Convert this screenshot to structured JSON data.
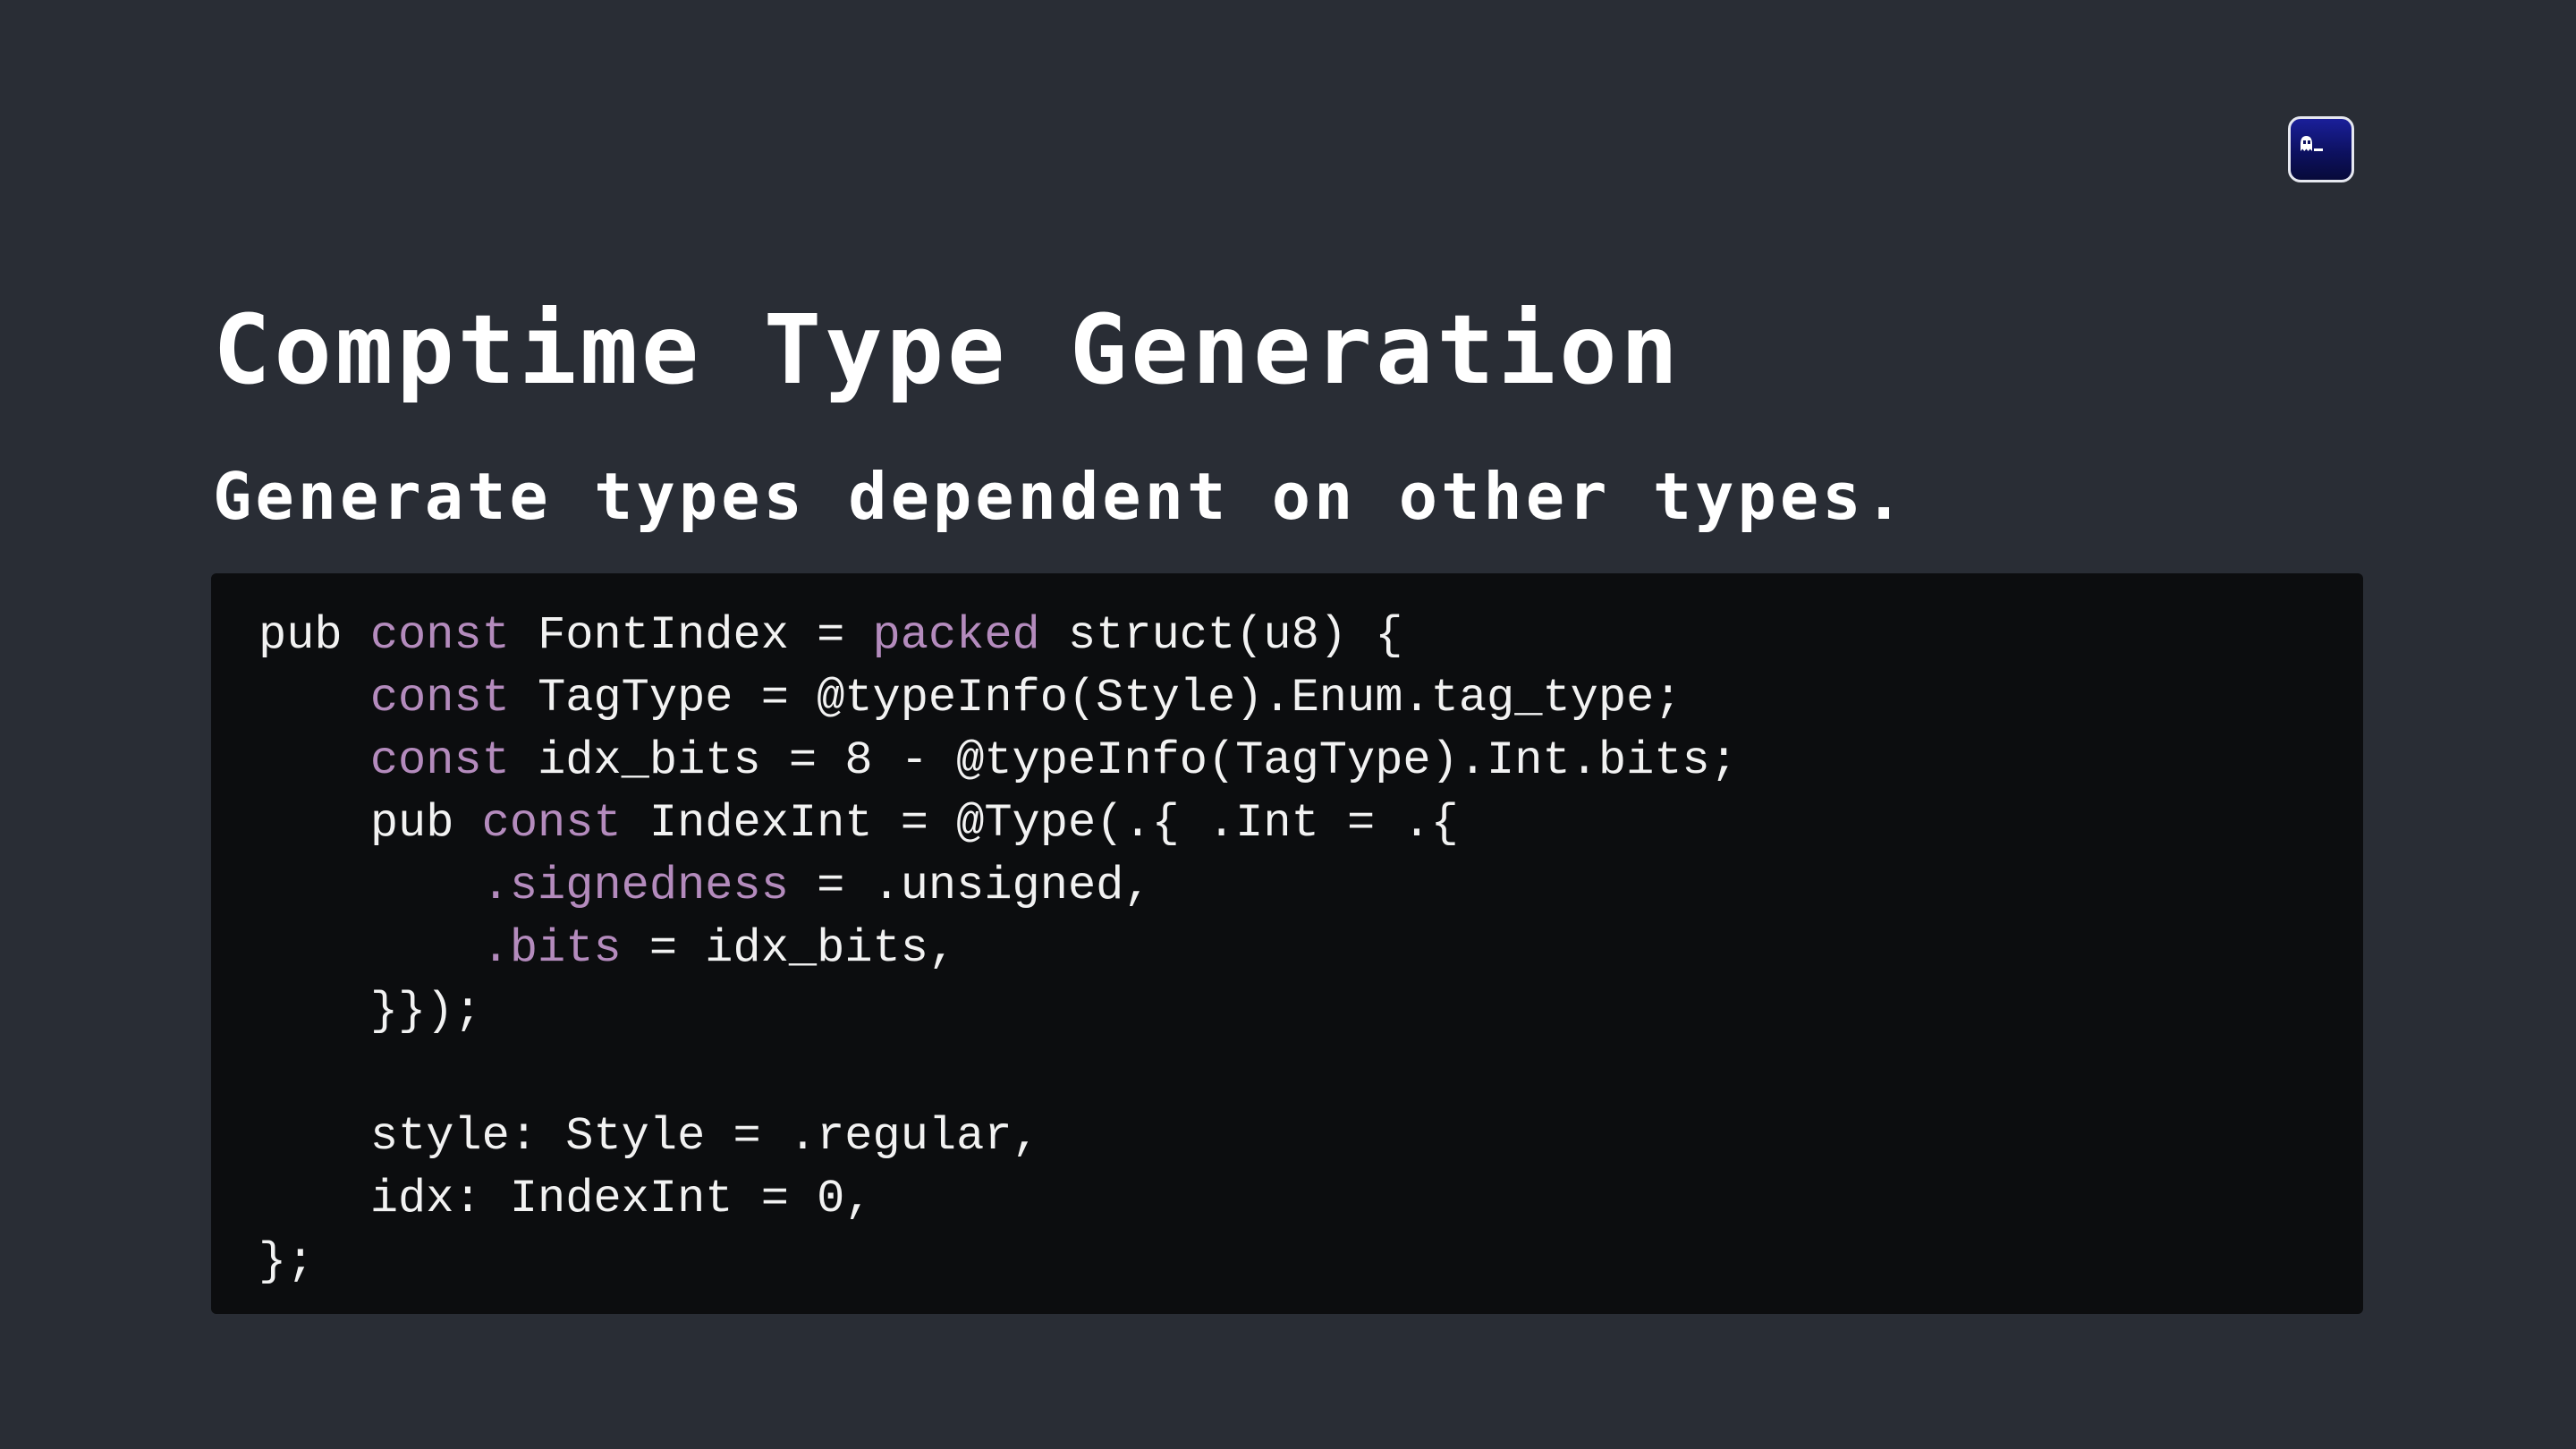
{
  "slide": {
    "title": "Comptime Type Generation",
    "subtitle": "Generate types dependent on other types."
  },
  "icon": {
    "name": "ghostty-terminal-app-icon",
    "colors": {
      "background": "#0d1160",
      "border": "#e6e8f0",
      "glyph": "#ffffff"
    }
  },
  "theme": {
    "page_background": "#292d35",
    "code_background": "#0c0d0f",
    "code_text": "#f2f2f2",
    "code_keyword": "#b48bbd"
  },
  "code": {
    "language": "zig",
    "lines": [
      [
        {
          "t": "pub ",
          "k": "plain"
        },
        {
          "t": "const",
          "k": "kw"
        },
        {
          "t": " FontIndex = ",
          "k": "plain"
        },
        {
          "t": "packed",
          "k": "kw"
        },
        {
          "t": " struct(u8) {",
          "k": "plain"
        }
      ],
      [
        {
          "t": "    ",
          "k": "plain"
        },
        {
          "t": "const",
          "k": "kw"
        },
        {
          "t": " TagType = @typeInfo(Style).Enum.tag_type;",
          "k": "plain"
        }
      ],
      [
        {
          "t": "    ",
          "k": "plain"
        },
        {
          "t": "const",
          "k": "kw"
        },
        {
          "t": " idx_bits = 8 - @typeInfo(TagType).Int.bits;",
          "k": "plain"
        }
      ],
      [
        {
          "t": "    pub ",
          "k": "plain"
        },
        {
          "t": "const",
          "k": "kw"
        },
        {
          "t": " IndexInt = @Type(.{ .Int = .{",
          "k": "plain"
        }
      ],
      [
        {
          "t": "        ",
          "k": "plain"
        },
        {
          "t": ".signedness",
          "k": "kw"
        },
        {
          "t": " = .unsigned,",
          "k": "plain"
        }
      ],
      [
        {
          "t": "        ",
          "k": "plain"
        },
        {
          "t": ".bits",
          "k": "kw"
        },
        {
          "t": " = idx_bits,",
          "k": "plain"
        }
      ],
      [
        {
          "t": "    }});",
          "k": "plain"
        }
      ],
      [],
      [
        {
          "t": "    style: Style = .regular,",
          "k": "plain"
        }
      ],
      [
        {
          "t": "    idx: IndexInt = 0,",
          "k": "plain"
        }
      ],
      [
        {
          "t": "};",
          "k": "plain"
        }
      ]
    ]
  }
}
